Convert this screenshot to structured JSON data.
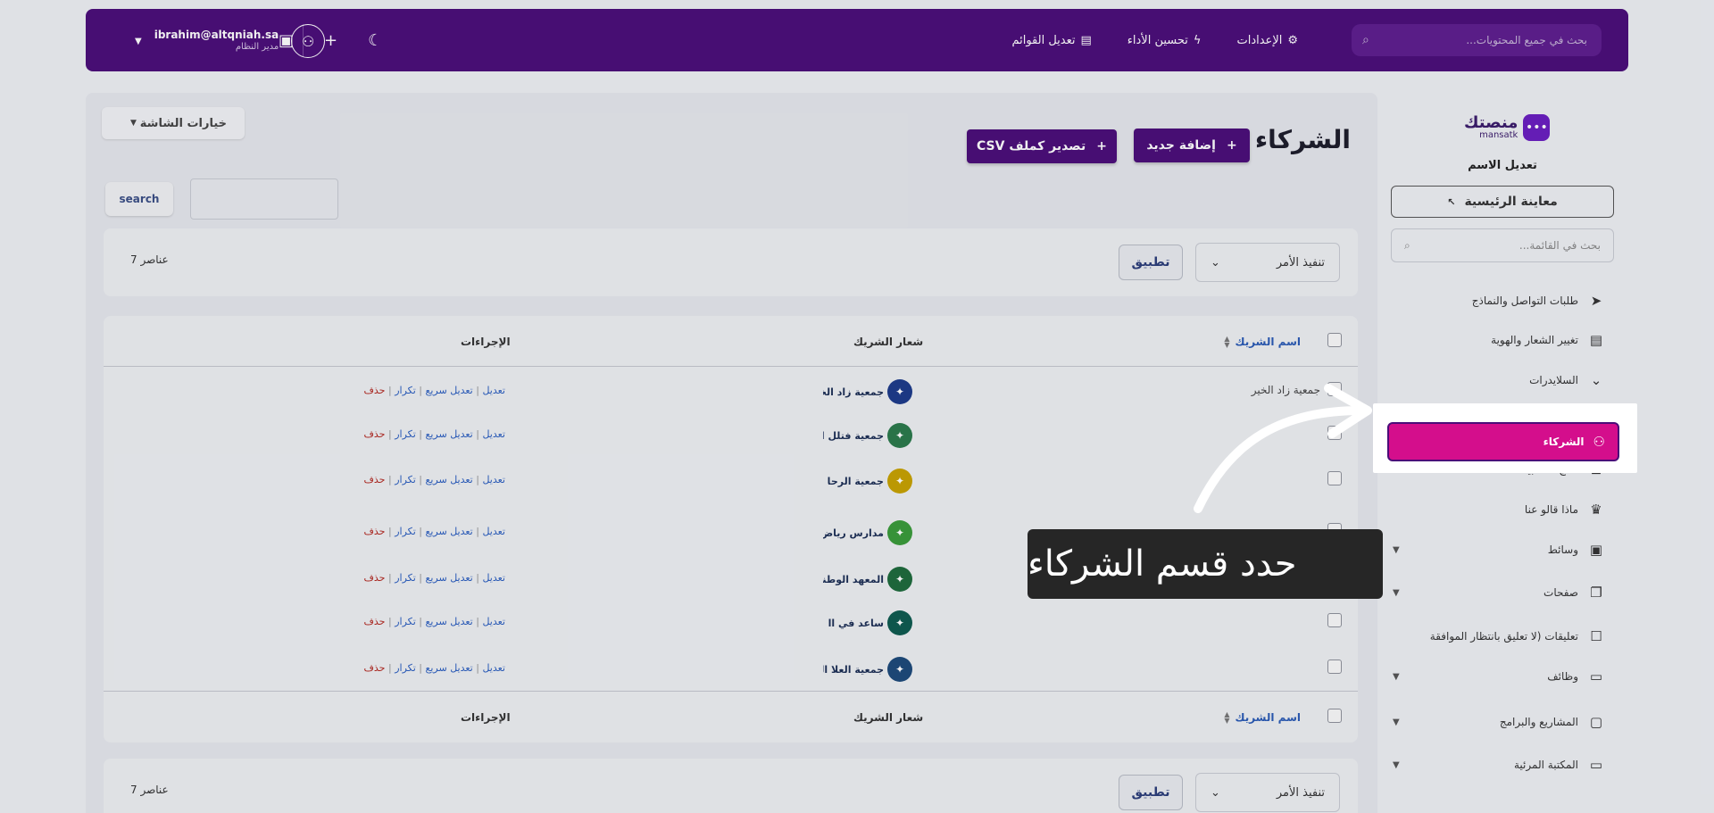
{
  "topbar": {
    "search_placeholder": "بحث في جميع المحتويات...",
    "nav": [
      {
        "label": "الإعدادات",
        "icon": "gear-icon"
      },
      {
        "label": "تحسين الأداء",
        "icon": "bolt-icon"
      },
      {
        "label": "تعديل القوائم",
        "icon": "layout-icon"
      }
    ],
    "icons": [
      "moon-icon",
      "plus-icon",
      "image-icon"
    ],
    "user": {
      "email": "ibrahim@altqniah.sa",
      "role": "مدير النظام"
    }
  },
  "main": {
    "screen_options": "خيارات الشاشة",
    "title": "الشركاء",
    "add_new": "إضافة جديد",
    "export_csv": "تصدير كملف CSV",
    "search_button": "search",
    "bulk_action": "تنفيذ الأمر",
    "apply": "تطبيق",
    "item_count": "7 عناصر",
    "columns": {
      "name": "اسم الشريك",
      "logo": "شعار الشريك",
      "actions": "الإجراءات"
    },
    "rows": [
      {
        "name": "جمعية زاد الخير",
        "logo_text": "جمعية زاد الخير",
        "logo_color": "#1c3b8a"
      },
      {
        "name": "",
        "logo_text": "جمعية فتلل الرياض",
        "logo_color": "#2b7a4b"
      },
      {
        "name": "",
        "logo_text": "جمعية الرحا الخيري",
        "logo_color": "#c8a200"
      },
      {
        "name": "",
        "logo_text": "مدارس رياض الأطفال",
        "logo_color": "#3a9b3a"
      },
      {
        "name": "",
        "logo_text": "المعهد الوطني للتعليم",
        "logo_color": "#1e6b3c"
      },
      {
        "name": "",
        "logo_text": "ساعد في اا",
        "logo_color": "#0d5b4f"
      },
      {
        "name": "",
        "logo_text": "جمعية العلا الخيرية",
        "logo_color": "#1c4a7a"
      }
    ],
    "row_actions": {
      "edit": "تعديل",
      "quick_edit": "تعديل سريع",
      "duplicate": "تكرار",
      "delete": "حذف",
      "sep": "|"
    }
  },
  "sidebar": {
    "brand_name": "منصتك",
    "brand_sub": "mansatk",
    "edit_name": "تعديل الاسم",
    "preview": "معاينة الرئيسية",
    "search_placeholder": "بحث في القائمة...",
    "items": [
      {
        "label": "طلبات التواصل والنماذج",
        "icon": "send-icon"
      },
      {
        "label": "تغيير الشعار والهوية",
        "icon": "layout-icon"
      },
      {
        "label": "السلايدرات",
        "icon": "chevron-down-icon"
      },
      {
        "label": "الشركاء",
        "icon": "partners-icon"
      },
      {
        "label": "نتائج الاستبيانات",
        "icon": "grid-icon"
      },
      {
        "label": "ماذا قالو عنا",
        "icon": "crown-icon"
      },
      {
        "label": "وسائط",
        "icon": "image-icon"
      },
      {
        "label": "صفحات",
        "icon": "pages-icon"
      },
      {
        "label": "تعليقات (لا تعليق بانتظار الموافقة",
        "icon": "comment-icon"
      },
      {
        "label": "وظائف",
        "icon": "briefcase-icon"
      },
      {
        "label": "المشاريع والبرامج",
        "icon": "box-icon"
      },
      {
        "label": "المكتبة المرئية",
        "icon": "tv-icon"
      }
    ]
  },
  "tutorial": {
    "callout": "حدد قسم الشركاء"
  },
  "colors": {
    "brand": "#4b0d79",
    "highlight": "#d40e8c"
  }
}
